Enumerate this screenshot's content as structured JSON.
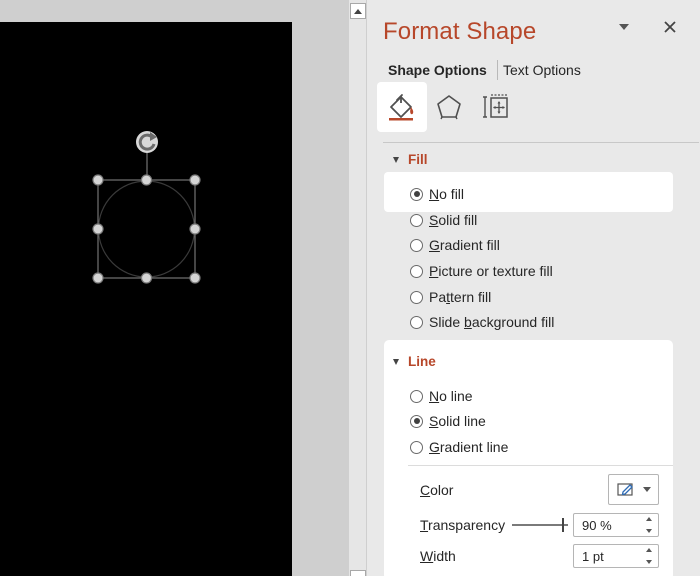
{
  "colors": {
    "accent": "#b7472a",
    "slide_background": "#000000",
    "pane_background": "#e9e9e9"
  },
  "pane": {
    "title": "Format Shape",
    "menu_icon": "chevron-down-icon",
    "close_icon": "close-icon",
    "tabs": [
      {
        "label": "Shape Options",
        "active": true
      },
      {
        "label": "Text Options",
        "active": false
      }
    ],
    "categories": [
      {
        "icon": "paint-bucket-icon",
        "active": true
      },
      {
        "icon": "pentagon-icon",
        "active": false
      },
      {
        "icon": "size-properties-icon",
        "active": false
      }
    ]
  },
  "fill": {
    "header": "Fill",
    "options": [
      {
        "mnemonic": "N",
        "rest": "o fill",
        "pre": "",
        "selected": true
      },
      {
        "mnemonic": "S",
        "rest": "olid fill",
        "pre": "",
        "selected": false
      },
      {
        "mnemonic": "G",
        "rest": "radient fill",
        "pre": "",
        "selected": false
      },
      {
        "mnemonic": "P",
        "rest": "icture or texture fill",
        "pre": "",
        "selected": false
      },
      {
        "mnemonic": "t",
        "rest": "tern fill",
        "pre": "Pa",
        "selected": false
      },
      {
        "mnemonic": "b",
        "rest": "ackground fill",
        "pre": "Slide ",
        "selected": false
      }
    ]
  },
  "line": {
    "header": "Line",
    "options": [
      {
        "mnemonic": "N",
        "rest": "o line",
        "pre": "",
        "selected": false
      },
      {
        "mnemonic": "S",
        "rest": "olid line",
        "pre": "",
        "selected": true
      },
      {
        "mnemonic": "G",
        "rest": "radient line",
        "pre": "",
        "selected": false
      }
    ],
    "color_label": {
      "mnemonic": "C",
      "rest": "olor"
    },
    "color_icon": "pen-color-icon",
    "transparency_label": {
      "mnemonic": "T",
      "rest": "ransparency"
    },
    "transparency_value": "90 %",
    "transparency_level": 0.9,
    "width_label": {
      "mnemonic": "W",
      "rest": "idth"
    },
    "width_value": "1 pt"
  }
}
